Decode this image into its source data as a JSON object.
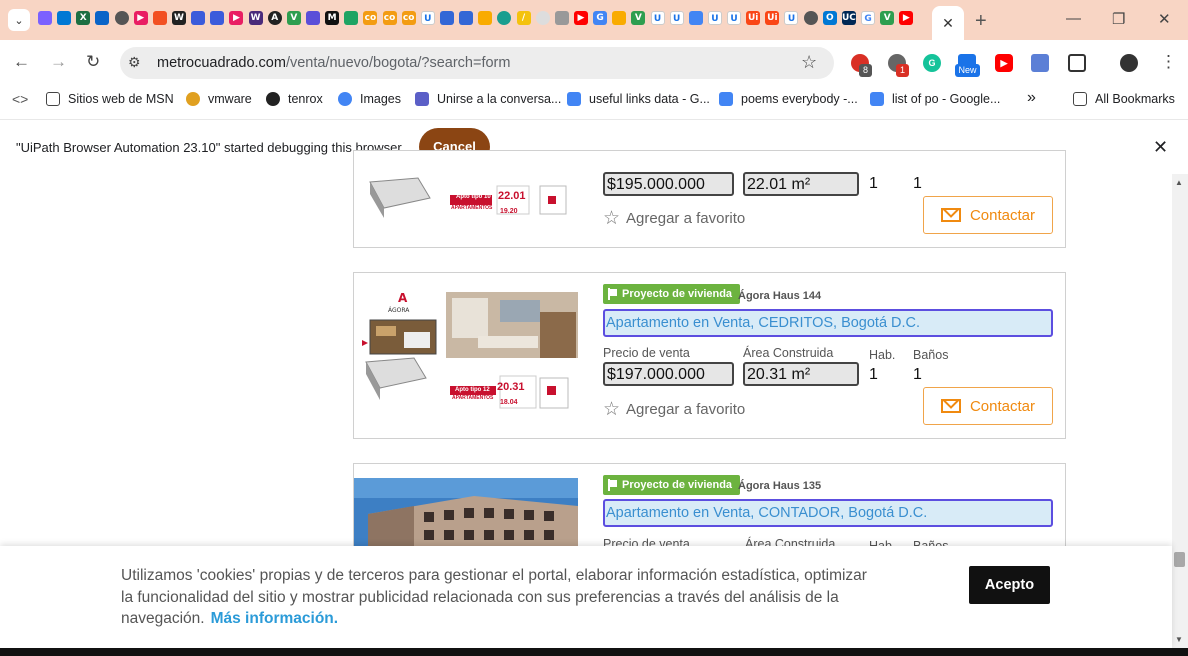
{
  "browser": {
    "active_tab_close": "✕",
    "new_tab": "+",
    "window_controls": {
      "minimize": "—",
      "restore": "❐",
      "close": "✕"
    },
    "url_host": "metrocuadrado.com",
    "url_path": "/venta/nuevo/bogota/?search=form",
    "extension_badges": {
      "first": "8",
      "second": "1",
      "new_label": "New"
    }
  },
  "bookmarks": [
    {
      "label": "Sitios web de MSN",
      "color": "#333"
    },
    {
      "label": "vmware",
      "color": "#e0a020"
    },
    {
      "label": "tenrox",
      "color": "#222"
    },
    {
      "label": "Images",
      "color": "#4285f4"
    },
    {
      "label": "Unirse a la conversa...",
      "color": "#5b5fc7"
    },
    {
      "label": "useful links data - G...",
      "color": "#4285f4"
    },
    {
      "label": "poems everybody -...",
      "color": "#4285f4"
    },
    {
      "label": "list of po - Google...",
      "color": "#4285f4"
    }
  ],
  "bookmarks_overflow": "»",
  "all_bookmarks": "All Bookmarks",
  "infobar": {
    "message": "\"UiPath Browser Automation 23.10\" started debugging this browser",
    "cancel": "Cancel",
    "close": "✕"
  },
  "listings": [
    {
      "price": "$195.000.000",
      "area": "22.01 m²",
      "rooms": "1",
      "baths": "1",
      "favorite": "Agregar a favorito",
      "contact": "Contactar"
    },
    {
      "tag": "Proyecto de vivienda",
      "project": "Ágora Haus 144",
      "title": "Apartamento en Venta, CEDRITOS, Bogotá D.C.",
      "price_label": "Precio de venta",
      "area_label": "Área Construida",
      "rooms_label": "Hab.",
      "baths_label": "Baños",
      "price": "$197.000.000",
      "area": "20.31 m²",
      "rooms": "1",
      "baths": "1",
      "favorite": "Agregar a favorito",
      "contact": "Contactar",
      "plan_a": "Apto tipo 12",
      "plan_b": "20.31",
      "plan_c": "APARTAMENTOS",
      "plan_d": "18.04"
    },
    {
      "tag": "Proyecto de vivienda",
      "project": "Ágora Haus 135",
      "title": "Apartamento en Venta, CONTADOR, Bogotá D.C.",
      "price_label": "Precio de venta",
      "area_label": "Área Construida",
      "rooms_label": "Hab.",
      "baths_label": "Baños"
    }
  ],
  "plan_first": {
    "type": "Apto tipo 10",
    "area": "22.01",
    "label": "APARTAMENTOS",
    "small": "19.20"
  },
  "cookie": {
    "text": "Utilizamos 'cookies' propias y de terceros para gestionar el portal, elaborar información estadística, optimizar la funcionalidad del sitio y mostrar publicidad relacionada con sus preferencias a través del análisis de la navegación.",
    "more": "Más información.",
    "accept": "Acepto"
  },
  "colors": {
    "tab_strip": "#f8d5c4",
    "tag_green": "#6cb33f",
    "contact_orange": "#f08a10",
    "cancel_brown": "#8b4513",
    "title_blue": "#3a8fd0"
  }
}
